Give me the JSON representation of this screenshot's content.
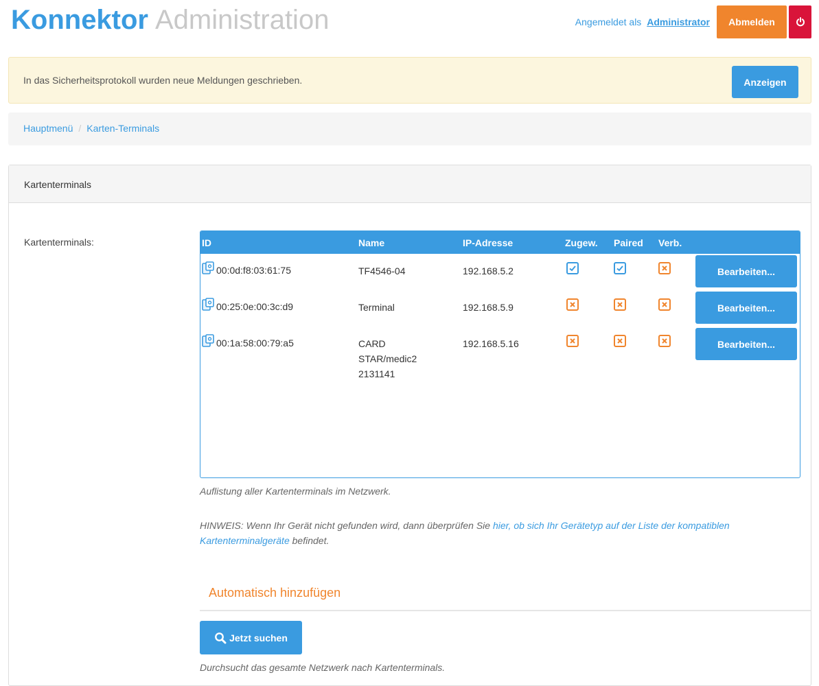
{
  "header": {
    "brand_strong": "Konnektor",
    "brand_light": "Administration",
    "logged_in_prefix": "Angemeldet als",
    "logged_in_user": "Administrator",
    "logout_label": "Abmelden",
    "power_icon": "power-icon"
  },
  "alert": {
    "message": "In das Sicherheitsprotokoll wurden neue Meldungen geschrieben.",
    "button_label": "Anzeigen"
  },
  "breadcrumb": {
    "items": [
      "Hauptmenü",
      "Karten-Terminals"
    ],
    "separator": "/"
  },
  "panel": {
    "title": "Kartenterminals",
    "field_label": "Kartenterminals:",
    "table": {
      "columns": [
        "ID",
        "Name",
        "IP-Adresse",
        "Zugew.",
        "Paired",
        "Verb."
      ],
      "rows": [
        {
          "id": "00:0d:f8:03:61:75",
          "name": "TF4546-04",
          "ip": "192.168.5.2",
          "assigned": true,
          "paired": true,
          "connected": false,
          "edit_label": "Bearbeiten..."
        },
        {
          "id": "00:25:0e:00:3c:d9",
          "name": "Terminal",
          "ip": "192.168.5.9",
          "assigned": false,
          "paired": false,
          "connected": false,
          "edit_label": "Bearbeiten..."
        },
        {
          "id": "00:1a:58:00:79:a5",
          "name": "CARD STAR/medic2 2131141",
          "ip": "192.168.5.16",
          "assigned": false,
          "paired": false,
          "connected": false,
          "edit_label": "Bearbeiten..."
        }
      ]
    },
    "help_list": "Auflistung aller Kartenterminals im Netzwerk.",
    "hint_prefix": "HINWEIS: Wenn Ihr Gerät nicht gefunden wird, dann überprüfen Sie ",
    "hint_link": "hier, ob sich Ihr Gerätetyp auf der Liste der kompatiblen Kartenterminalgeräte",
    "hint_suffix": " befindet.",
    "auto_add_title": "Automatisch hinzufügen",
    "search_label": "Jetzt suchen",
    "search_help": "Durchsucht das gesamte Netzwerk nach Kartenterminals."
  },
  "colors": {
    "accent": "#3a9be0",
    "warning": "#f0852d",
    "danger": "#d9143a",
    "alert_bg": "#fcf6de"
  }
}
